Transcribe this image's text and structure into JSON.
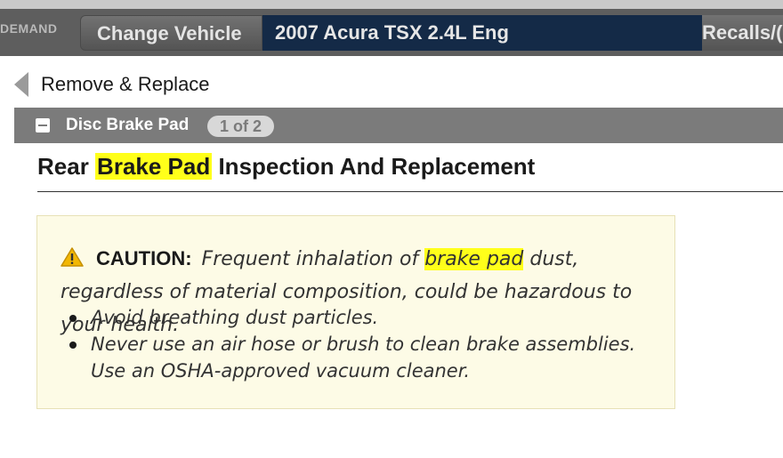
{
  "header": {
    "brand": "DEMAND",
    "change_vehicle_label": "Change Vehicle",
    "vehicle": "2007 Acura TSX 2.4L Eng",
    "recalls_label": "Recalls/("
  },
  "nav": {
    "back_label": "Remove & Replace",
    "back_icon": "chevron-left-icon"
  },
  "section": {
    "title": "Disc Brake Pad",
    "page_indicator": "1 of 2",
    "collapse_icon": "minus-square-icon"
  },
  "document": {
    "title_prefix": "Rear ",
    "title_highlight": "Brake Pad",
    "title_suffix": " Inspection And Replacement",
    "highlight_color": "#ffff1a"
  },
  "caution": {
    "icon": "warning-triangle-icon",
    "label": "CAUTION:",
    "text_before": " Frequent inhalation of ",
    "text_highlight": "brake pad",
    "text_after": " dust, regardless of material composition, could be hazardous to your health.",
    "bullets": [
      "Avoid breathing dust particles.",
      "Never use an air hose or brush to clean brake assemblies. Use an OSHA-approved vacuum cleaner."
    ]
  }
}
